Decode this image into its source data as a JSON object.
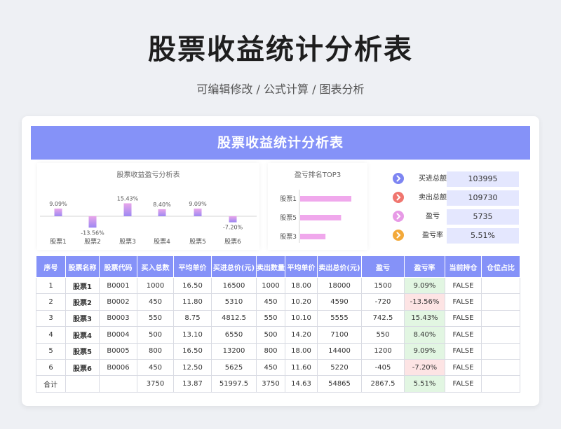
{
  "page": {
    "title": "股票收益统计分析表",
    "subtitle": "可编辑修改 /  公式计算  /  图表分析"
  },
  "banner": {
    "title": "股票收益统计分析表"
  },
  "bar_chart_title": "股票收益盈亏分析表",
  "top3_title": "盈亏排名TOP3",
  "chart_data": [
    {
      "type": "bar",
      "title": "股票收益盈亏分析表",
      "categories": [
        "股票1",
        "股票2",
        "股票3",
        "股票4",
        "股票5",
        "股票6"
      ],
      "values": [
        9.09,
        -13.56,
        15.43,
        8.4,
        9.09,
        -7.2
      ],
      "labels": [
        "9.09%",
        "-13.56%",
        "15.43%",
        "8.40%",
        "9.09%",
        "-7.20%"
      ],
      "colors": {
        "top": "#e9a6ea",
        "bottom": "#9d88f2"
      }
    },
    {
      "type": "bar",
      "orientation": "horizontal",
      "title": "盈亏排名TOP3",
      "categories": [
        "股票1",
        "股票5",
        "股票3"
      ],
      "values": [
        1500,
        1200,
        742.5
      ],
      "color": "#f0a8ec"
    }
  ],
  "kpis": [
    {
      "label": "买进总额",
      "value": "103995",
      "color": "#7d85f2"
    },
    {
      "label": "卖出总额",
      "value": "109730",
      "color": "#f0766f"
    },
    {
      "label": "盈亏",
      "value": "5735",
      "color": "#e79ae6"
    },
    {
      "label": "盈亏率",
      "value": "5.51%",
      "color": "#f3a93a"
    }
  ],
  "table": {
    "headers": [
      "序号",
      "股票名称",
      "股票代码",
      "买入总数",
      "平均单价",
      "买进总价(元)",
      "卖出数量",
      "平均单价",
      "卖出总价(元)",
      "盈亏",
      "盈亏率",
      "当前持仓",
      "仓位占比"
    ],
    "rows": [
      [
        "1",
        "股票1",
        "B0001",
        "1000",
        "16.50",
        "16500",
        "1000",
        "18.00",
        "18000",
        "1500",
        "9.09%",
        "FALSE",
        ""
      ],
      [
        "2",
        "股票2",
        "B0002",
        "450",
        "11.80",
        "5310",
        "450",
        "10.20",
        "4590",
        "-720",
        "-13.56%",
        "FALSE",
        ""
      ],
      [
        "3",
        "股票3",
        "B0003",
        "550",
        "8.75",
        "4812.5",
        "550",
        "10.10",
        "5555",
        "742.5",
        "15.43%",
        "FALSE",
        ""
      ],
      [
        "4",
        "股票4",
        "B0004",
        "500",
        "13.10",
        "6550",
        "500",
        "14.20",
        "7100",
        "550",
        "8.40%",
        "FALSE",
        ""
      ],
      [
        "5",
        "股票5",
        "B0005",
        "800",
        "16.50",
        "13200",
        "800",
        "18.00",
        "14400",
        "1200",
        "9.09%",
        "FALSE",
        ""
      ],
      [
        "6",
        "股票6",
        "B0006",
        "450",
        "12.50",
        "5625",
        "450",
        "11.60",
        "5220",
        "-405",
        "-7.20%",
        "FALSE",
        ""
      ]
    ],
    "total": [
      "合计",
      "",
      "",
      "3750",
      "13.87",
      "51997.5",
      "3750",
      "14.63",
      "54865",
      "2867.5",
      "5.51%",
      "FALSE",
      ""
    ]
  }
}
